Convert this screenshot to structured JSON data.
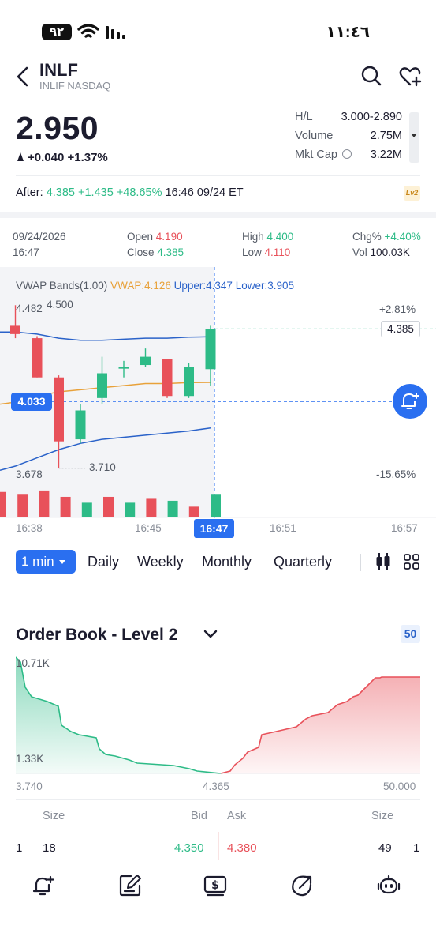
{
  "status": {
    "battery": "٩٢",
    "time": "١١:٤٦"
  },
  "header": {
    "ticker": "INLF",
    "subtitle": "INLIF NASDAQ"
  },
  "quote": {
    "price": "2.950",
    "change": "+0.040 +1.37%",
    "hl_label": "H/L",
    "hl_value": "3.000-2.890",
    "volume_label": "Volume",
    "volume_value": "2.75M",
    "mktcap_label": "Mkt Cap",
    "mktcap_value": "3.22M"
  },
  "after_hours": {
    "label": "After:",
    "price": "4.385",
    "change": "+1.435",
    "percent": "+48.65%",
    "time": "16:46 09/24 ET",
    "badge": "Lv2"
  },
  "ohlc": {
    "date": "09/24/2026",
    "time": "16:47",
    "open_label": "Open",
    "open": "4.190",
    "close_label": "Close",
    "close": "4.385",
    "high_label": "High",
    "high": "4.400",
    "low_label": "Low",
    "low": "4.110",
    "chg_label": "Chg%",
    "chg": "+4.40%",
    "vol_label": "Vol",
    "vol": "100.03K"
  },
  "chart": {
    "indicator": "VWAP Bands(1.00)",
    "vwap": "VWAP:4.126",
    "upper": "Upper:4.347",
    "lower": "Lower:3.905",
    "y_top": "4.482",
    "y_bottom": "3.678",
    "max_annot": "4.500",
    "min_annot": "3.710",
    "pct_top": "+2.81%",
    "pct_bottom": "-15.65%",
    "last_price": "4.385",
    "cursor_price": "4.033",
    "times": [
      "16:38",
      "16:45",
      "16:47",
      "16:51",
      "16:57"
    ],
    "colors": {
      "up": "#2dbb87",
      "down": "#e8515a",
      "vwap": "#e8a13a",
      "band": "#2a62c9",
      "accent": "#2a6ff0"
    }
  },
  "chart_data": {
    "type": "candlestick",
    "ylim": [
      3.678,
      4.482
    ],
    "x": [
      "16:38",
      "16:39",
      "16:40",
      "16:41",
      "16:42",
      "16:43",
      "16:44",
      "16:45",
      "16:46",
      "16:47"
    ],
    "ohlc": [
      [
        4.4,
        4.5,
        4.34,
        4.36
      ],
      [
        4.34,
        4.35,
        4.15,
        4.15
      ],
      [
        4.15,
        4.16,
        3.71,
        3.84
      ],
      [
        3.85,
        4.02,
        3.83,
        3.99
      ],
      [
        4.05,
        4.25,
        4.02,
        4.17
      ],
      [
        4.2,
        4.23,
        4.15,
        4.2
      ],
      [
        4.21,
        4.29,
        4.2,
        4.25
      ],
      [
        4.24,
        4.24,
        4.05,
        4.06
      ],
      [
        4.06,
        4.22,
        4.05,
        4.2
      ],
      [
        4.19,
        4.4,
        4.11,
        4.385
      ]
    ],
    "vwap": [
      4.03,
      4.06,
      4.08,
      4.09,
      4.1,
      4.11,
      4.12,
      4.12,
      4.125,
      4.126
    ],
    "upper": [
      4.37,
      4.36,
      4.34,
      4.33,
      4.33,
      4.335,
      4.34,
      4.34,
      4.345,
      4.347
    ],
    "lower": [
      3.72,
      3.76,
      3.8,
      3.83,
      3.85,
      3.86,
      3.87,
      3.88,
      3.89,
      3.905
    ],
    "volume": [
      52,
      48,
      55,
      42,
      30,
      42,
      30,
      38,
      34,
      22,
      48
    ]
  },
  "tabs": {
    "interval": "1 min",
    "items": [
      "Daily",
      "Weekly",
      "Monthly",
      "Quarterly"
    ]
  },
  "order_book": {
    "title": "Order Book - Level 2",
    "badge": "50",
    "depth_high": "10.71K",
    "depth_low": "1.33K",
    "axis_left": "3.740",
    "axis_mid": "4.365",
    "axis_right": "50.000",
    "head": {
      "size": "Size",
      "bid": "Bid",
      "ask": "Ask",
      "size2": "Size"
    },
    "row": {
      "level": "1",
      "bid_size": "18",
      "bid": "4.350",
      "ask": "4.380",
      "ask_size": "49",
      "level2": "1"
    }
  }
}
